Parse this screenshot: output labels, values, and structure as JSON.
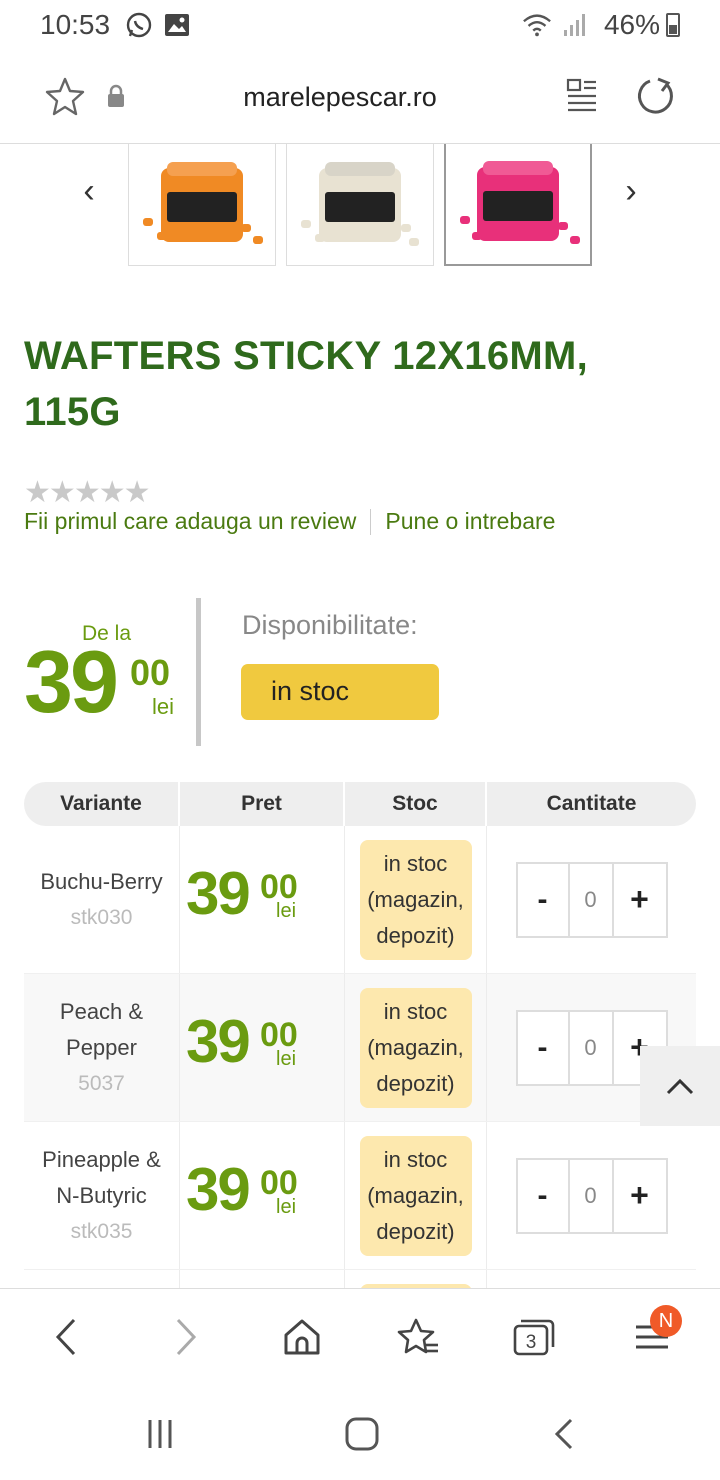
{
  "status": {
    "time": "10:53",
    "battery": "46%"
  },
  "browser": {
    "url": "marelepescar.ro"
  },
  "gallery": {
    "prev": "‹",
    "next": "›",
    "thumbs": [
      {
        "name": "orange",
        "color": "#f08a24"
      },
      {
        "name": "white",
        "color": "#e8e2d2"
      },
      {
        "name": "pink",
        "color": "#e8307a"
      }
    ],
    "active_index": 2
  },
  "product": {
    "title": "WAFTERS STICKY 12X16MM, 115G",
    "review_cta": "Fii primul care adauga un review",
    "question_cta": "Pune o intrebare",
    "rating_stars": 0,
    "price_prefix": "De la",
    "price_int": "39",
    "price_cents": "00",
    "currency": "lei",
    "availability_label": "Disponibilitate:",
    "availability_value": "in stoc"
  },
  "variants": {
    "headers": {
      "variant": "Variante",
      "price": "Pret",
      "stock": "Stoc",
      "qty": "Cantitate"
    },
    "rows": [
      {
        "name": "Buchu-Berry",
        "code": "stk030",
        "price_int": "39",
        "price_cents": "00",
        "currency": "lei",
        "stock": "in stoc (magazin, depozit)",
        "qty": "0",
        "minus": "-",
        "plus": "+"
      },
      {
        "name": "Peach & Pepper",
        "code": "5037",
        "price_int": "39",
        "price_cents": "00",
        "currency": "lei",
        "stock": "in stoc (magazin, depozit)",
        "qty": "0",
        "minus": "-",
        "plus": "+"
      },
      {
        "name": "Pineapple & N-Butyric",
        "code": "stk035",
        "price_int": "39",
        "price_cents": "00",
        "currency": "lei",
        "stock": "in stoc (magazin, depozit)",
        "qty": "0",
        "minus": "-",
        "plus": "+"
      }
    ]
  },
  "toolbar": {
    "tabs_count": "3",
    "notification": "N"
  },
  "colors": {
    "title_green": "#2f6a1c",
    "price_green": "#6a9b10",
    "stock_yellow": "#f0c93f",
    "stock_light": "#fde8ae"
  }
}
